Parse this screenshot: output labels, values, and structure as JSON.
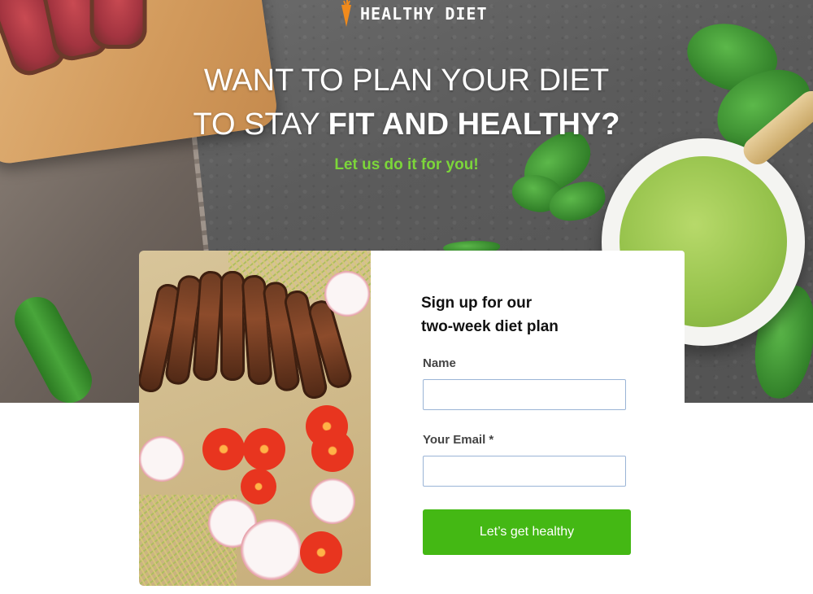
{
  "header": {
    "brand": "HEALTHY DIET",
    "logo_icon": "carrot-icon"
  },
  "hero": {
    "headline_line1": "WANT TO PLAN YOUR DIET",
    "headline_line2_prefix": "TO STAY ",
    "headline_line2_bold": "FIT AND HEALTHY?",
    "tagline": "Let us do it for you!"
  },
  "signup": {
    "title_line1": "Sign up for our",
    "title_line2": "two-week diet plan",
    "name_label": "Name",
    "name_value": "",
    "email_label": "Your Email *",
    "email_value": "",
    "submit_label": "Let’s get healthy"
  },
  "colors": {
    "accent_green": "#44b814",
    "tagline_green": "#7cd63a",
    "input_border": "#9ab4d6"
  }
}
